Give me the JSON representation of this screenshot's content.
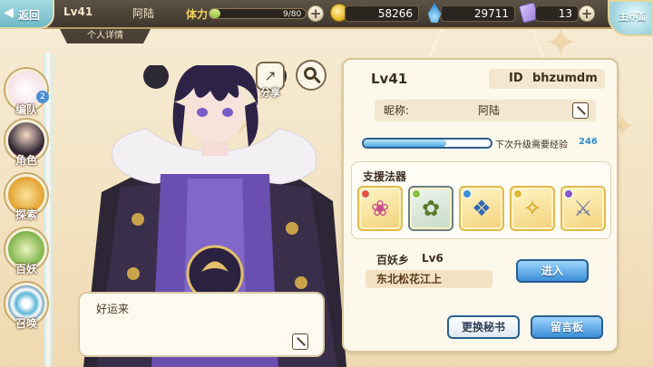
{
  "topbar": {
    "back_label": "返回",
    "level": "Lv41",
    "nickname": "阿陆",
    "stamina_label": "体力",
    "stamina_text": "9/80",
    "stamina_fraction": 0.11,
    "gold": "58266",
    "gems": "29711",
    "tickets": "13",
    "main_label": "主界面"
  },
  "tab_title": "个人详情",
  "nav": [
    {
      "label": "编队",
      "badge": "2"
    },
    {
      "label": "角色"
    },
    {
      "label": "探索"
    },
    {
      "label": "百妖"
    },
    {
      "label": "召唤"
    }
  ],
  "share_label": "分享",
  "speech": "好运来",
  "panel": {
    "level": "Lv41",
    "id_key": "ID",
    "id_value": "bhzumdm",
    "nick_key": "昵称:",
    "nick_value": "阿陆",
    "exp_label": "下次升级需要经验",
    "exp_value": "246",
    "exp_fraction": 0.65,
    "support_title": "支援法器",
    "home_name": "百妖乡",
    "home_level": "Lv6",
    "home_location": "东北松花江上",
    "enter_label": "进入",
    "change_secretary_label": "更换秘书",
    "message_board_label": "留言板"
  },
  "colors": {
    "accent_blue": "#3c8fd8",
    "panel_bg": "#fdf8ec",
    "frame_gold": "#d9c79c"
  }
}
